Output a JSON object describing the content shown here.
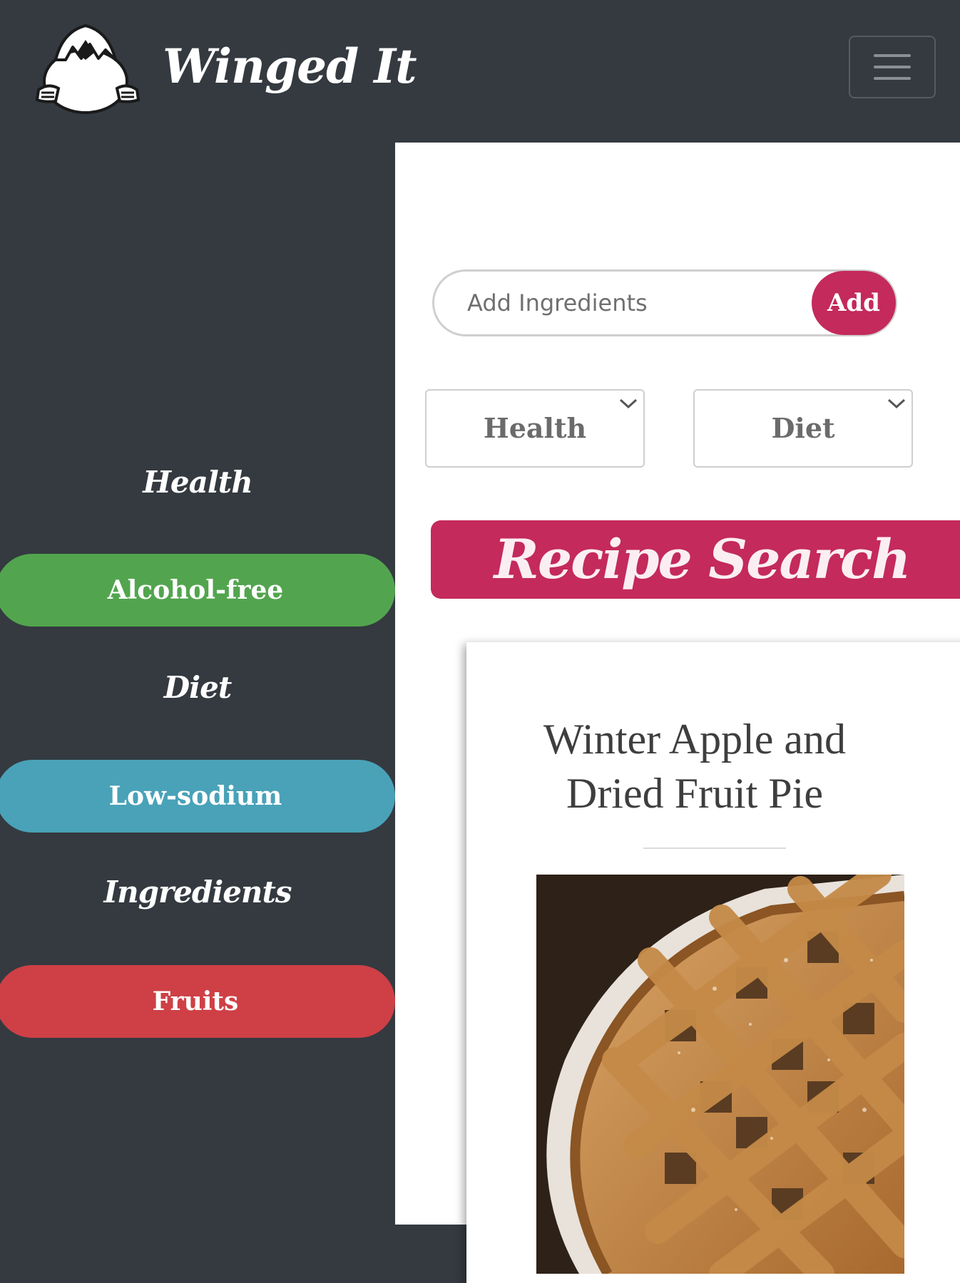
{
  "navbar": {
    "brand": "Winged It",
    "logo_icon": "hatching-chick-logo",
    "toggler_icon": "hamburger-menu-icon"
  },
  "sidebar": {
    "sections": [
      {
        "heading": "Health",
        "pill": "Alcohol-free",
        "color": "#52a54e"
      },
      {
        "heading": "Diet",
        "pill": "Low-sodium",
        "color": "#49a2b8"
      },
      {
        "heading": "Ingredients",
        "pill": "Fruits",
        "color": "#ce4046"
      }
    ]
  },
  "search": {
    "placeholder": "Add Ingredients",
    "value": "",
    "add_label": "Add"
  },
  "filters": {
    "health_label": "Health",
    "diet_label": "Diet"
  },
  "recipe_search": {
    "title": "Recipe Search"
  },
  "result_card": {
    "title_line1": "Winter Apple and",
    "title_line2": "Dried Fruit Pie",
    "image_subject": "lattice-top fruit pie photo"
  },
  "colors": {
    "background": "#343a40",
    "accent": "#c42a5c",
    "content": "#ffffff"
  }
}
